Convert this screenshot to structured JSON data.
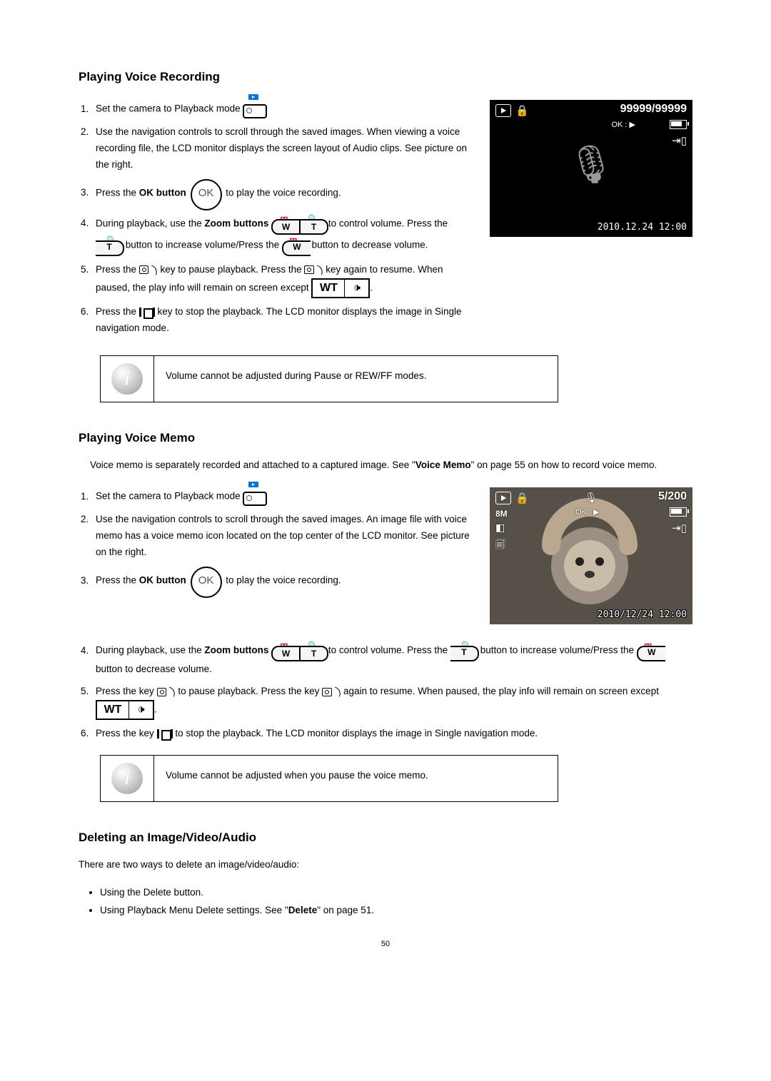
{
  "page_number": "50",
  "voice_recording": {
    "heading": "Playing Voice Recording",
    "steps": {
      "s1a": "Set the camera to Playback mode ",
      "s1b": ".",
      "s2": "Use the navigation controls to scroll through the saved images. When viewing a voice recording file, the LCD monitor displays the screen layout of Audio clips. See picture on the right.",
      "s3a": "Press the ",
      "s3b": "OK button",
      "s3c": " to play the voice recording.",
      "s4a": "During playback, use the ",
      "s4b": "Zoom buttons",
      "s4c": " to control volume. Press the ",
      "s4d": " button to increase volume/Press the ",
      "s4e": " button to decrease volume.",
      "s5a": "Press the ",
      "s5b": " key to pause playback. Press the ",
      "s5c": " key again to resume. When paused, the play info will remain on screen except ",
      "s5d": ".",
      "s6a": "Press the ",
      "s6b": " key to stop the playback. The LCD monitor displays the image in Single navigation mode."
    },
    "note": "Volume cannot be adjusted during Pause or REW/FF modes.",
    "lcd": {
      "counter": "99999/99999",
      "ok_hint": "OK : ▶",
      "datetime": "2010.12.24 12:00"
    }
  },
  "voice_memo": {
    "heading": "Playing Voice Memo",
    "intro_a": "Voice memo is separately recorded and attached to a captured image. See \"",
    "intro_b": "Voice Memo",
    "intro_c": "\" on page 55 on how to record voice memo.",
    "steps": {
      "s1a": "Set the camera to Playback mode ",
      "s1b": ".",
      "s2": "Use the navigation controls to scroll through the saved images. An image file with voice memo has a voice memo icon located on the top center of the LCD monitor. See picture on the right.",
      "s3a": "Press the ",
      "s3b": "OK button",
      "s3c": " to play the voice recording.",
      "s4a": "During playback, use the ",
      "s4b": "Zoom buttons",
      "s4c": " to control volume. Press the ",
      "s4d": " button to increase volume/Press the ",
      "s4e": " button to decrease volume.",
      "s5a": "Press the key ",
      "s5b": " to pause playback. Press the key ",
      "s5c": " again to resume. When paused, the play info will remain on screen except ",
      "s5d": ".",
      "s6a": "Press the key ",
      "s6b": " to stop the playback. The LCD monitor displays the image in Single navigation mode."
    },
    "note": "Volume cannot be adjusted when you pause the voice memo.",
    "lcd": {
      "counter": "5/200",
      "ok_hint": "OK : ▶",
      "size_badge": "8M",
      "datetime": "2010/12/24 12:00"
    }
  },
  "deleting": {
    "heading": "Deleting an Image/Video/Audio",
    "intro": "There are two ways to delete an image/video/audio:",
    "b1": "Using the Delete button.",
    "b2a": "Using Playback Menu Delete settings. See \"",
    "b2b": "Delete",
    "b2c": "\" on page 51."
  },
  "icons": {
    "ok_text": "OK",
    "w": "W",
    "t": "T",
    "wt": "WT",
    "speaker": "🕩"
  }
}
